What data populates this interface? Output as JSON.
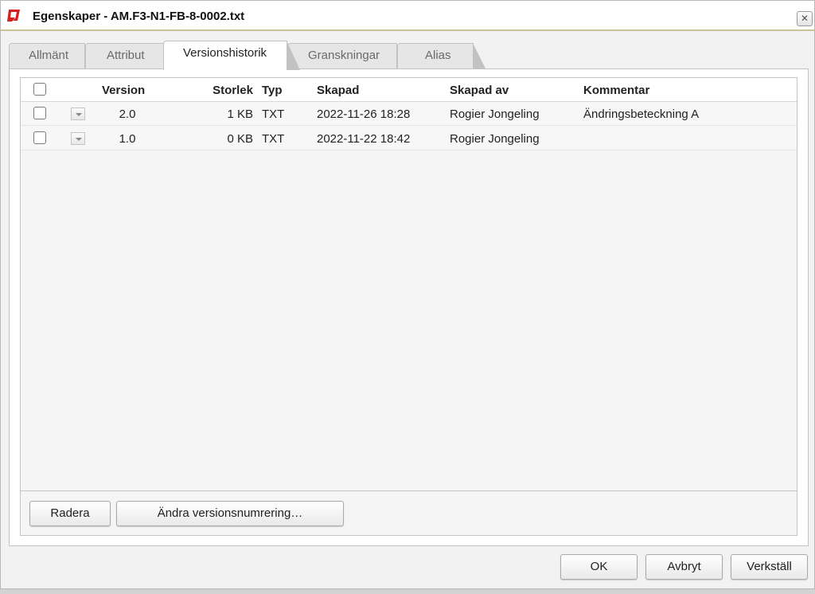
{
  "window": {
    "title": "Egenskaper - AM.F3-N1-FB-8-0002.txt",
    "close_symbol": "✕",
    "accent_color": "#d42020"
  },
  "tabs": [
    {
      "label": "Allmänt",
      "active": false
    },
    {
      "label": "Attribut",
      "active": false
    },
    {
      "label": "Versionshistorik",
      "active": true
    },
    {
      "label": "Granskningar",
      "active": false
    },
    {
      "label": "Alias",
      "active": false
    }
  ],
  "grid": {
    "columns": {
      "version": "Version",
      "size": "Storlek",
      "type": "Typ",
      "created": "Skapad",
      "created_by": "Skapad av",
      "comment": "Kommentar"
    },
    "rows": [
      {
        "version": "2.0",
        "size": "1 KB",
        "type": "TXT",
        "created": "2022-11-26 18:28",
        "created_by": "Rogier Jongeling",
        "comment": "Ändringsbeteckning A"
      },
      {
        "version": "1.0",
        "size": "0 KB",
        "type": "TXT",
        "created": "2022-11-22 18:42",
        "created_by": "Rogier Jongeling",
        "comment": ""
      }
    ]
  },
  "panel_buttons": {
    "delete": "Radera",
    "renumber": "Ändra versionsnumrering…"
  },
  "dialog_buttons": {
    "ok": "OK",
    "cancel": "Avbryt",
    "apply": "Verkställ"
  }
}
